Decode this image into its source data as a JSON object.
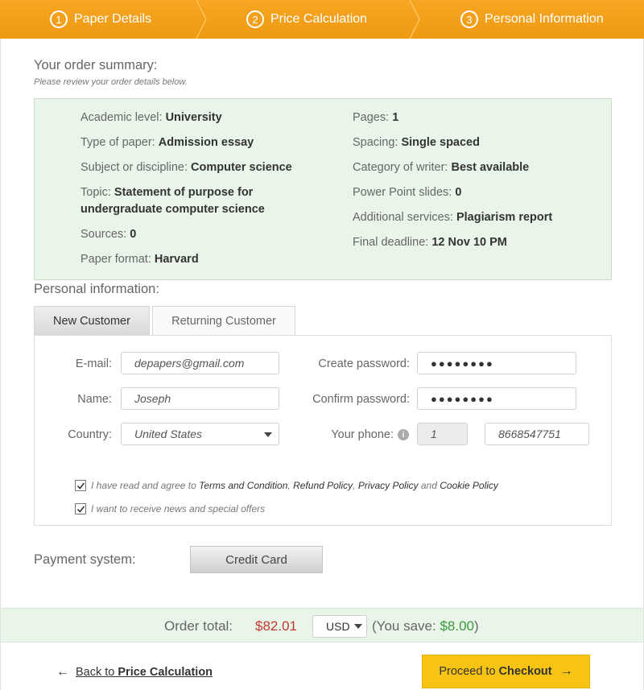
{
  "steps": [
    {
      "num": "1",
      "label": "Paper Details"
    },
    {
      "num": "2",
      "label": "Price Calculation"
    },
    {
      "num": "3",
      "label": "Personal Information"
    }
  ],
  "summary": {
    "title": "Your order summary:",
    "note": "Please review your order details below.",
    "left": [
      {
        "label": "Academic level:",
        "value": "University"
      },
      {
        "label": "Type of paper:",
        "value": "Admission essay"
      },
      {
        "label": "Subject or discipline:",
        "value": "Computer science"
      },
      {
        "label": "Topic:",
        "value": "Statement of purpose for undergraduate computer science"
      },
      {
        "label": "Sources:",
        "value": "0"
      },
      {
        "label": "Paper format:",
        "value": "Harvard"
      }
    ],
    "right": [
      {
        "label": "Pages:",
        "value": "1"
      },
      {
        "label": "Spacing:",
        "value": "Single spaced"
      },
      {
        "label": "Category of writer:",
        "value": "Best available"
      },
      {
        "label": "Power Point slides:",
        "value": "0"
      },
      {
        "label": "Additional services:",
        "value": "Plagiarism report"
      },
      {
        "label": "Final deadline:",
        "value": "12 Nov 10 PM"
      }
    ]
  },
  "personal": {
    "title": "Personal information:",
    "tabs": {
      "new": "New Customer",
      "returning": "Returning Customer"
    },
    "email_label": "E-mail:",
    "email_value": "depapers@gmail.com",
    "name_label": "Name:",
    "name_value": "Joseph",
    "country_label": "Country:",
    "country_value": "United States",
    "create_password_label": "Create password:",
    "create_password_value": "●●●●●●●●",
    "confirm_password_label": "Confirm password:",
    "confirm_password_value": "●●●●●●●●",
    "phone_label": "Your phone:",
    "phone_code": "1",
    "phone_number": "8668547751",
    "agree": {
      "prefix": "I have read and agree to ",
      "terms": "Terms and Condition",
      "sep1": ", ",
      "refund": "Refund Policy",
      "sep2": ", ",
      "privacy": "Privacy Policy",
      "and": " and ",
      "cookie": "Cookie Policy"
    },
    "news": "I want to receive news and special offers"
  },
  "payment": {
    "label": "Payment system:",
    "method": "Credit Card"
  },
  "total": {
    "label": "Order total:",
    "amount": "$82.01",
    "currency": "USD",
    "save_prefix": "(You save: ",
    "save_amount": "$8.00",
    "save_suffix": ")"
  },
  "nav": {
    "back_prefix": "Back to ",
    "back_target": "Price Calculation",
    "checkout_prefix": "Proceed to ",
    "checkout_target": "Checkout"
  },
  "colors": {
    "steps_bar": "#f39e1a",
    "summary_bg": "#eaf5ea",
    "checkout_button": "#f7c414",
    "total_amount": "#c0392b",
    "save_amount": "#3a9a3a"
  }
}
